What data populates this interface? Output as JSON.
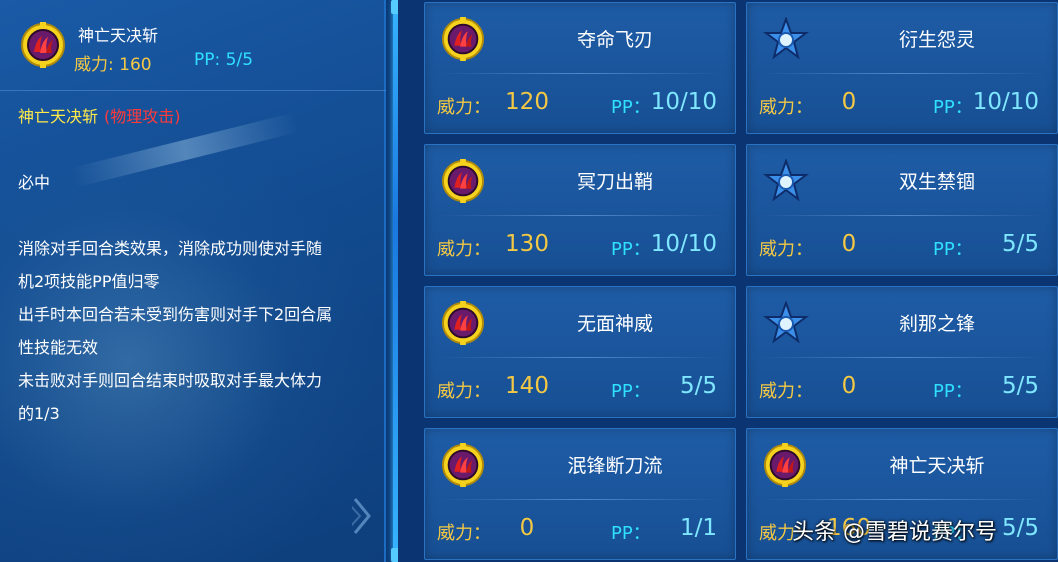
{
  "selected_skill": {
    "name": "神亡天决斩",
    "power_label": "威力",
    "power": "160",
    "pp_label": "PP",
    "pp": "5/5",
    "icon": "red-claw-icon"
  },
  "description": {
    "name": "神亡天决斩",
    "category": "(物理攻击)",
    "lines": [
      "必中",
      "消除对手回合类效果，消除成功则使对手随",
      "机2项技能PP值归零",
      "出手时本回合若未受到伤害则对手下2回合属",
      "性技能无效",
      "未击败对手则回合结束时吸取对手最大体力",
      "的1/3"
    ]
  },
  "labels": {
    "power": "威力：",
    "pp": "PP："
  },
  "skills": [
    {
      "name": "夺命飞刃",
      "power": "120",
      "pp": "10/10",
      "icon": "red-claw-icon"
    },
    {
      "name": "衍生怨灵",
      "power": "0",
      "pp": "10/10",
      "icon": "blue-star-icon"
    },
    {
      "name": "冥刀出鞘",
      "power": "130",
      "pp": "10/10",
      "icon": "red-claw-icon"
    },
    {
      "name": "双生禁锢",
      "power": "0",
      "pp": "5/5",
      "icon": "blue-star-icon"
    },
    {
      "name": "无面神威",
      "power": "140",
      "pp": "5/5",
      "icon": "red-claw-icon"
    },
    {
      "name": "刹那之锋",
      "power": "0",
      "pp": "5/5",
      "icon": "blue-star-icon"
    },
    {
      "name": "泯锋断刀流",
      "power": "0",
      "pp": "1/1",
      "icon": "red-claw-icon"
    },
    {
      "name": "神亡天决斩",
      "power": "160",
      "pp": "5/5",
      "icon": "red-claw-icon"
    }
  ],
  "watermark": "头条 @雪碧说赛尔号",
  "colors": {
    "power": "#f3c844",
    "pp": "#2fe0ff",
    "category": "#ff3a3a",
    "skill_name_highlight": "#ffe94a"
  }
}
